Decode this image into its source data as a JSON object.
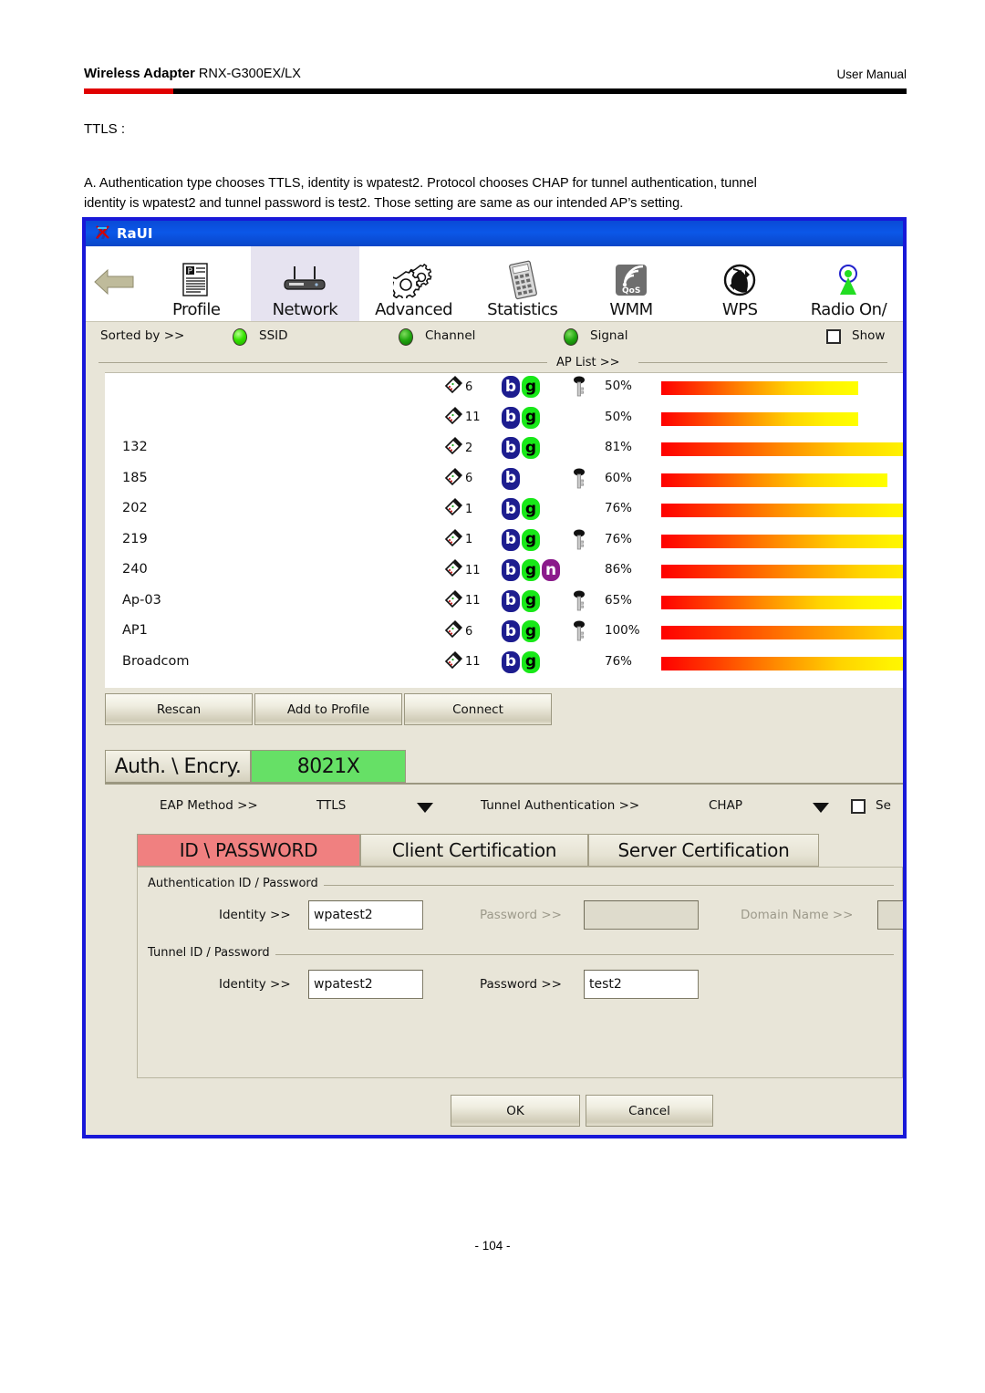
{
  "document": {
    "header_left_bold": "Wireless Adapter",
    "header_left_model": " RNX-G300EX/LX",
    "header_right": "User Manual",
    "section_label": "TTLS :",
    "paragraph_line1": "A. Authentication type chooses TTLS, identity is wpatest2.   Protocol chooses CHAP for tunnel authentication, tunnel",
    "paragraph_line2": "identity is wpatest2 and tunnel password is test2. Those setting are same as our intended AP’s setting.",
    "page_number": "- 104 -",
    "accent_red": "#E00000",
    "rule_color": "#000000"
  },
  "window": {
    "title": "RaUI",
    "title_icon": "raui-logo-icon",
    "border_color": "#1818D8",
    "face_color": "#E8E5D8"
  },
  "toolbar": {
    "back_icon": "back-arrow-icon",
    "items": [
      {
        "label": "Profile",
        "icon": "profile-document-icon",
        "selected": false
      },
      {
        "label": "Network",
        "icon": "router-icon",
        "selected": true
      },
      {
        "label": "Advanced",
        "icon": "gears-icon",
        "selected": false
      },
      {
        "label": "Statistics",
        "icon": "calculator-icon",
        "selected": false
      },
      {
        "label": "WMM",
        "icon": "qos-icon",
        "selected": false
      },
      {
        "label": "WPS",
        "icon": "wps-icon",
        "selected": false
      },
      {
        "label": "Radio On/",
        "icon": "radio-antenna-icon",
        "selected": false
      }
    ]
  },
  "sortbar": {
    "label": "Sorted by >>",
    "options": [
      {
        "label": "SSID",
        "selected": true
      },
      {
        "label": "Channel",
        "selected": false
      },
      {
        "label": "Signal",
        "selected": false
      }
    ],
    "show_checkbox_label": "Show",
    "show_checked": false
  },
  "ap_list": {
    "title": "AP List >>",
    "rows": [
      {
        "ssid": "",
        "channel": "6",
        "modes": [
          "b",
          "g"
        ],
        "secured": true,
        "signal": "50%",
        "signal_pct": 50
      },
      {
        "ssid": "",
        "channel": "11",
        "modes": [
          "b",
          "g"
        ],
        "secured": false,
        "signal": "50%",
        "signal_pct": 50
      },
      {
        "ssid": "132",
        "channel": "2",
        "modes": [
          "b",
          "g"
        ],
        "secured": false,
        "signal": "81%",
        "signal_pct": 81
      },
      {
        "ssid": "185",
        "channel": "6",
        "modes": [
          "b"
        ],
        "secured": true,
        "signal": "60%",
        "signal_pct": 60
      },
      {
        "ssid": "202",
        "channel": "1",
        "modes": [
          "b",
          "g"
        ],
        "secured": false,
        "signal": "76%",
        "signal_pct": 76
      },
      {
        "ssid": "219",
        "channel": "1",
        "modes": [
          "b",
          "g"
        ],
        "secured": true,
        "signal": "76%",
        "signal_pct": 76
      },
      {
        "ssid": "240",
        "channel": "11",
        "modes": [
          "b",
          "g",
          "n"
        ],
        "secured": false,
        "signal": "86%",
        "signal_pct": 86
      },
      {
        "ssid": "Ap-03",
        "channel": "11",
        "modes": [
          "b",
          "g"
        ],
        "secured": true,
        "signal": "65%",
        "signal_pct": 65
      },
      {
        "ssid": "AP1",
        "channel": "6",
        "modes": [
          "b",
          "g"
        ],
        "secured": true,
        "signal": "100%",
        "signal_pct": 100
      },
      {
        "ssid": "Broadcom",
        "channel": "11",
        "modes": [
          "b",
          "g"
        ],
        "secured": false,
        "signal": "76%",
        "signal_pct": 76
      }
    ]
  },
  "ap_buttons": {
    "rescan": "Rescan",
    "add_to_profile": "Add to Profile",
    "connect": "Connect"
  },
  "auth_panel": {
    "tab_auth": "Auth. \\ Encry.",
    "tab_8021x": "8021X",
    "tab_8021x_color": "#66E066",
    "eap_method_label": "EAP Method >>",
    "eap_method_value": "TTLS",
    "tunnel_auth_label": "Tunnel Authentication >>",
    "tunnel_auth_value": "CHAP",
    "session_checkbox_label": "Se",
    "session_checked": false
  },
  "inner_tabs": [
    {
      "label": "ID \\ PASSWORD",
      "active": true,
      "color": "#F08080"
    },
    {
      "label": "Client Certification",
      "active": false
    },
    {
      "label": "Server Certification",
      "active": false
    }
  ],
  "auth_id_group": {
    "title": "Authentication ID / Password",
    "identity_label": "Identity >>",
    "identity_value": "wpatest2",
    "identity_enabled": true,
    "password_label": "Password >>",
    "password_value": "",
    "password_enabled": false,
    "domain_label": "Domain Name >>",
    "domain_value": "",
    "domain_enabled": false
  },
  "tunnel_id_group": {
    "title": "Tunnel ID / Password",
    "identity_label": "Identity >>",
    "identity_value": "wpatest2",
    "identity_enabled": true,
    "password_label": "Password >>",
    "password_value": "test2",
    "password_enabled": true
  },
  "dialog_buttons": {
    "ok": "OK",
    "cancel": "Cancel"
  }
}
